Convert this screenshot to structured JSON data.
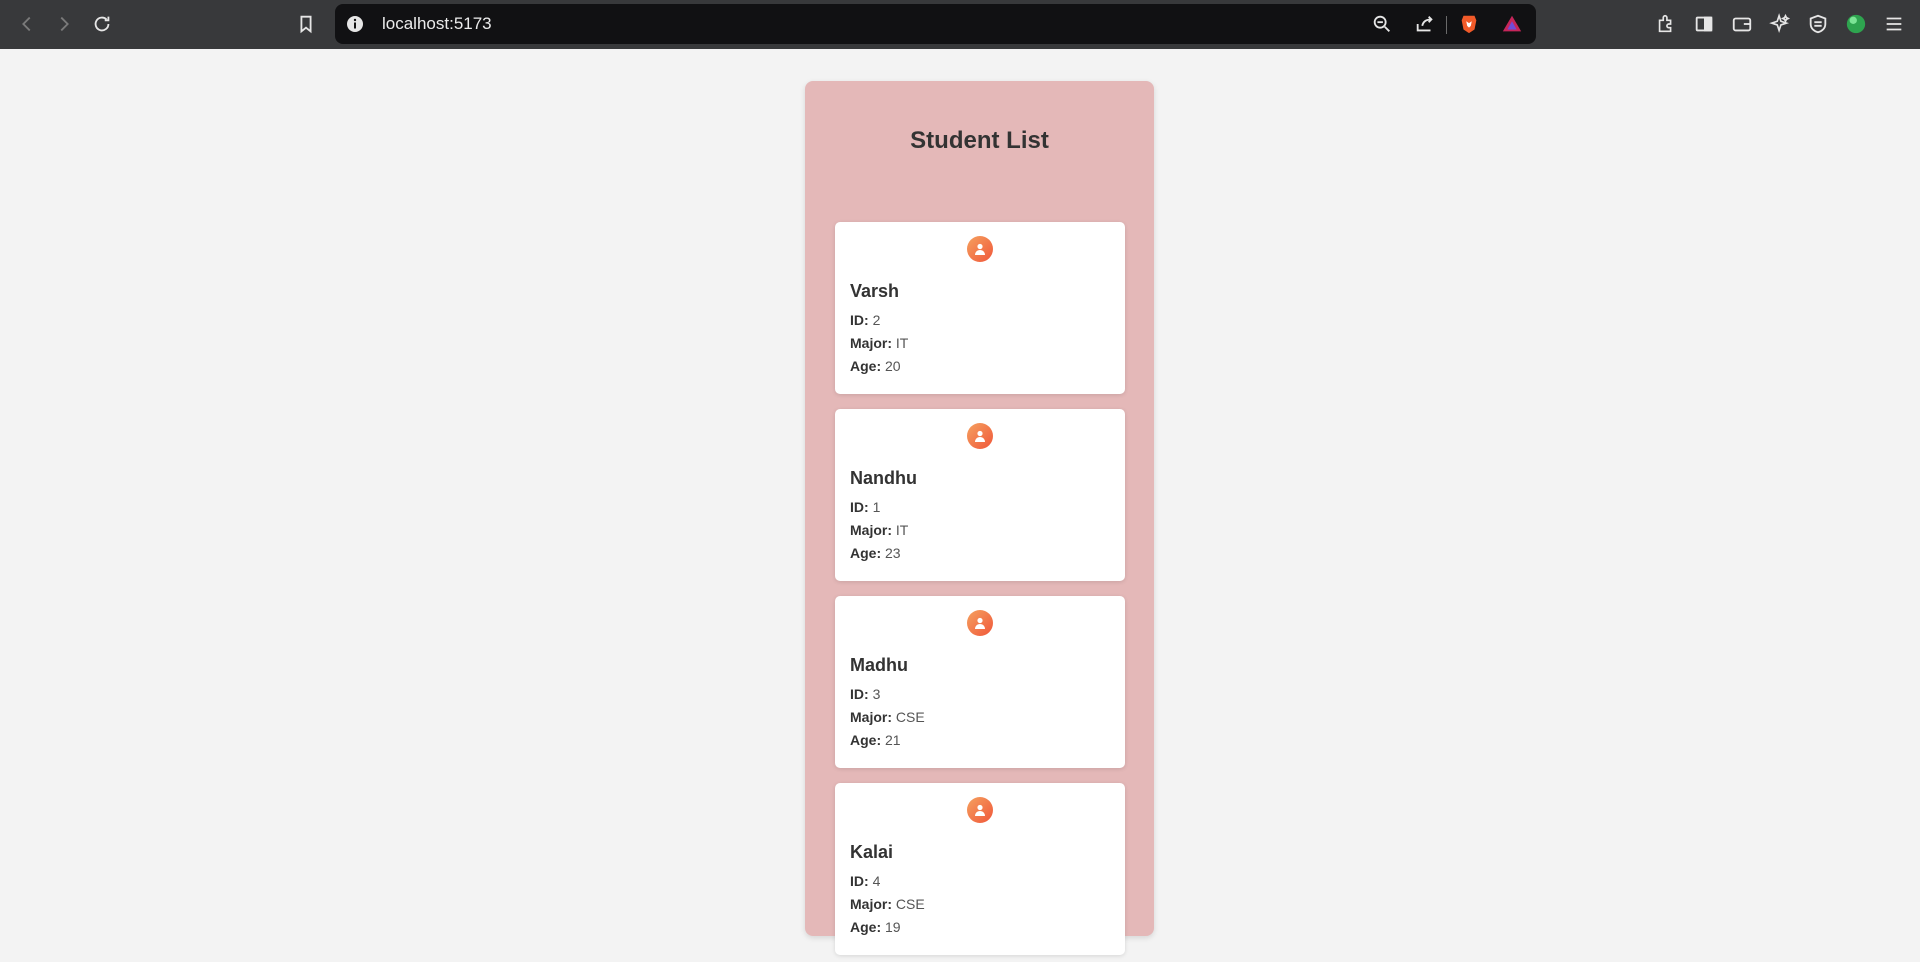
{
  "browser": {
    "url": "localhost:5173"
  },
  "page": {
    "title": "Student List",
    "labels": {
      "id": "ID:",
      "major": "Major:",
      "age": "Age:"
    },
    "students": [
      {
        "name": "Varsh",
        "id": "2",
        "major": "IT",
        "age": "20"
      },
      {
        "name": "Nandhu",
        "id": "1",
        "major": "IT",
        "age": "23"
      },
      {
        "name": "Madhu",
        "id": "3",
        "major": "CSE",
        "age": "21"
      },
      {
        "name": "Kalai",
        "id": "4",
        "major": "CSE",
        "age": "19"
      }
    ]
  },
  "colors": {
    "panel": "#e4b8b8",
    "avatar_start": "#f5a15f",
    "avatar_end": "#f0573a"
  }
}
